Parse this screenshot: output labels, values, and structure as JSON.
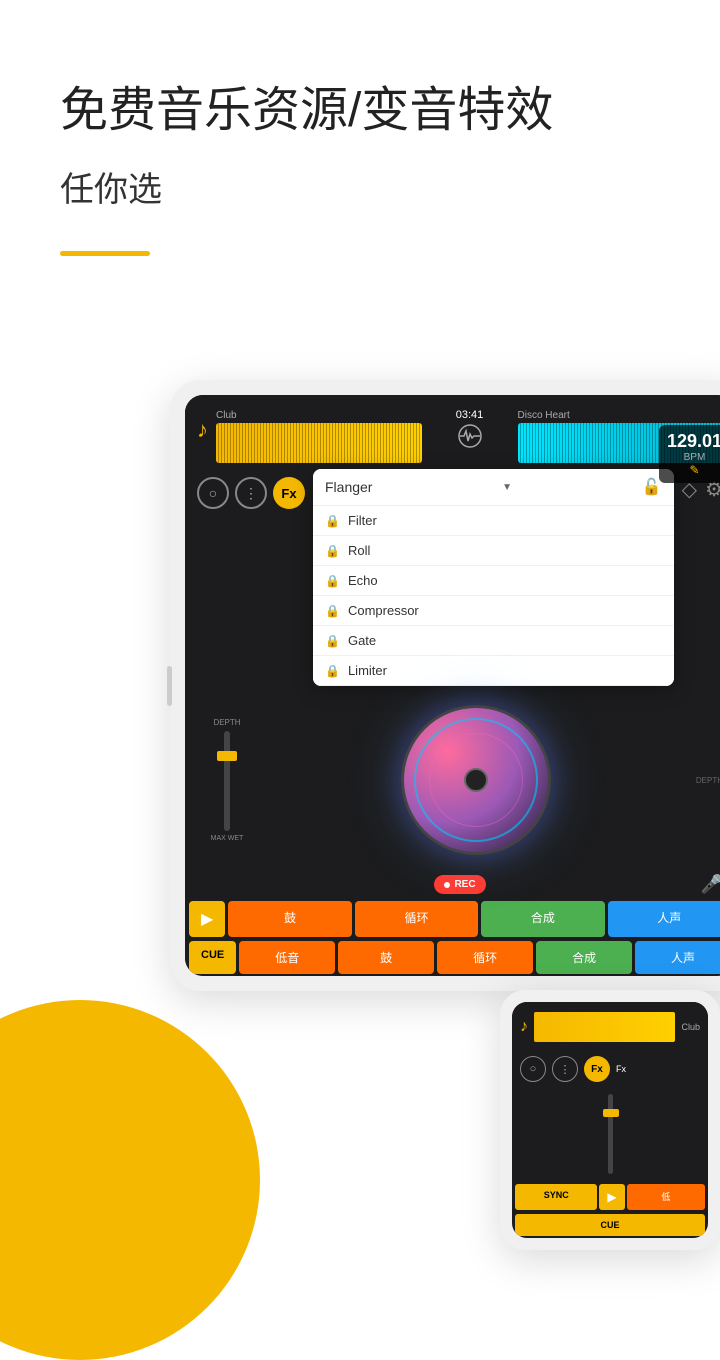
{
  "header": {
    "main_title": "免费音乐资源/变音特效",
    "sub_title": "任你选"
  },
  "dj_app_1": {
    "track_left": "Club",
    "track_time": "03:41",
    "track_right": "Disco Heart",
    "bpm": "129.01",
    "bpm_label": "BPM",
    "fx_selected": "Flanger",
    "fx_items": [
      "Filter",
      "Roll",
      "Echo",
      "Compressor",
      "Gate",
      "Limiter"
    ],
    "depth_top": "DEPTH",
    "max_wet": "MAX WET",
    "depth_bottom": "DEPTH",
    "rec_label": "REC",
    "pad_row1": [
      "鼓",
      "循环",
      "合成",
      "人声"
    ],
    "pad_row2": [
      "低音",
      "鼓",
      "循环",
      "合成",
      "人声"
    ],
    "cue_label": "CUE",
    "play_icon": "▶"
  },
  "dj_app_2": {
    "track_name": "Club",
    "sync_label": "SYNC",
    "cue_label": "CUE",
    "play_icon": "▶",
    "pad_row": [
      "低"
    ]
  },
  "icons": {
    "music_note": "♪",
    "lock": "🔒",
    "gear": "⚙",
    "diamond": "◇",
    "mic": "🎤",
    "play": "▶",
    "heartbeat": "〜"
  }
}
